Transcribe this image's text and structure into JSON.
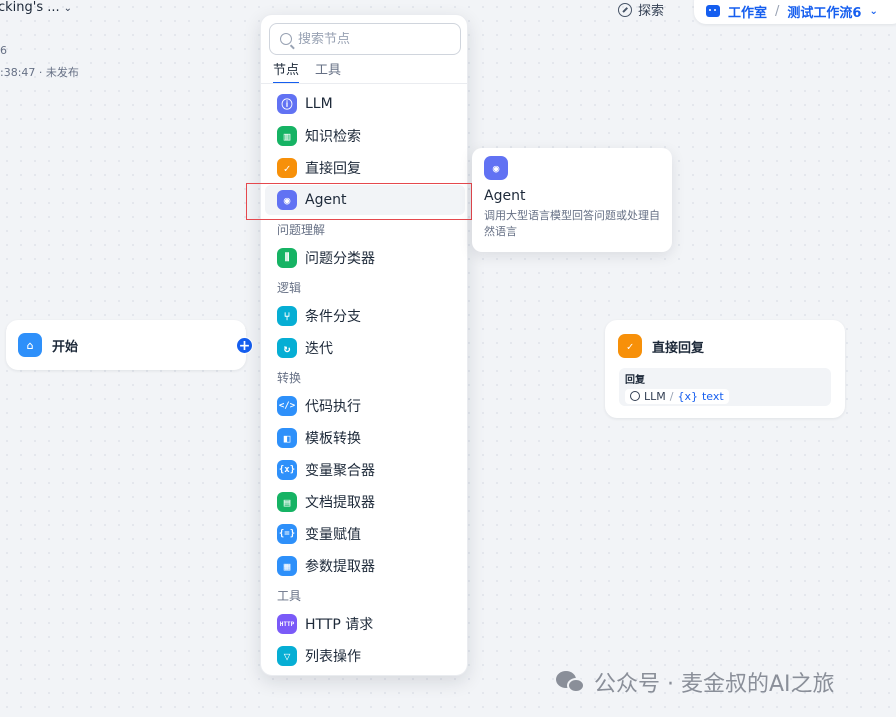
{
  "header": {
    "app_title": "cking's ...",
    "meta_number": "6",
    "meta_time": ":38:47 · 未发布",
    "explore_label": "探索",
    "studio_label": "工作室",
    "workflow_name": "测试工作流6"
  },
  "panel": {
    "search_placeholder": "搜索节点",
    "tabs": [
      "节点",
      "工具"
    ],
    "items": [
      {
        "label": "LLM",
        "icon": "llm-icon",
        "color": "#6172f3"
      },
      {
        "label": "知识检索",
        "icon": "knowledge-icon",
        "color": "#16b364"
      },
      {
        "label": "直接回复",
        "icon": "reply-icon",
        "color": "#f79009"
      },
      {
        "label": "Agent",
        "icon": "agent-icon",
        "color": "#6172f3"
      },
      {
        "label": "问题分类器",
        "icon": "classifier-icon",
        "color": "#16b364"
      },
      {
        "label": "条件分支",
        "icon": "branch-icon",
        "color": "#06aed4"
      },
      {
        "label": "迭代",
        "icon": "iteration-icon",
        "color": "#06aed4"
      },
      {
        "label": "代码执行",
        "icon": "code-icon",
        "color": "#2e90fa"
      },
      {
        "label": "模板转换",
        "icon": "template-icon",
        "color": "#2e90fa"
      },
      {
        "label": "变量聚合器",
        "icon": "aggregator-icon",
        "color": "#2e90fa"
      },
      {
        "label": "文档提取器",
        "icon": "doc-extract-icon",
        "color": "#16b364"
      },
      {
        "label": "变量赋值",
        "icon": "assign-icon",
        "color": "#2e90fa"
      },
      {
        "label": "参数提取器",
        "icon": "param-extract-icon",
        "color": "#2e90fa"
      },
      {
        "label": "HTTP 请求",
        "icon": "http-icon",
        "color": "#7a5af8"
      },
      {
        "label": "列表操作",
        "icon": "list-filter-icon",
        "color": "#06aed4"
      }
    ],
    "categories": [
      "问题理解",
      "逻辑",
      "转换",
      "工具"
    ]
  },
  "tooltip": {
    "title": "Agent",
    "description": "调用大型语言模型回答问题或处理自然语言"
  },
  "nodes": {
    "start_label": "开始",
    "reply_label": "直接回复",
    "reply_field": "回复",
    "reply_ref_node": "LLM",
    "reply_ref_var": "text"
  },
  "watermark": "公众号 · 麦金叔的AI之旅"
}
